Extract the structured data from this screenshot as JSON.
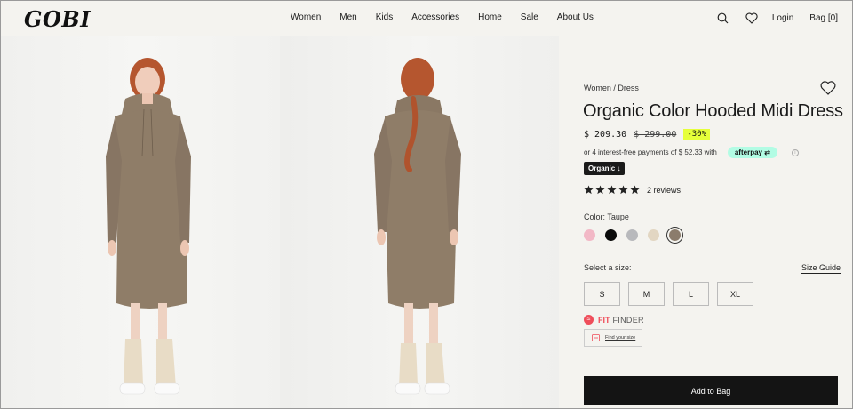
{
  "brand": {
    "logo": "GOBI"
  },
  "nav": {
    "items": [
      "Women",
      "Men",
      "Kids",
      "Accessories",
      "Home",
      "Sale",
      "About Us"
    ]
  },
  "header_right": {
    "login": "Login",
    "bag": "Bag [0]",
    "search_icon": "search-icon",
    "wishlist_icon": "heart-icon"
  },
  "product": {
    "breadcrumb": "Women / Dress",
    "title": "Organic Color Hooded Midi Dress",
    "price": "$ 209.30",
    "old_price": "$ 299.00",
    "discount": "-30%",
    "installments": "or 4 interest-free payments of $ 52.33 with",
    "afterpay": "afterpay",
    "organic_badge": "Organic ↓",
    "rating": 5,
    "reviews": "2 reviews",
    "color_label": "Color: Taupe",
    "colors": [
      "#f2b8c6",
      "#0b0b0b",
      "#b8b9bc",
      "#e2d6c2",
      "#8b7c6c"
    ],
    "selected_color_index": 4,
    "size_label": "Select a size:",
    "size_guide": "Size Guide",
    "sizes": [
      "S",
      "M",
      "L",
      "XL"
    ],
    "fit_finder": {
      "brand_a": "FIT",
      "brand_b": "FINDER",
      "link": "Find your size"
    },
    "add_to_bag": "Add to Bag"
  },
  "colors": {
    "accent_lime": "#e6ff3a",
    "afterpay_mint": "#b2fce4",
    "fit_red": "#ef4d5a",
    "dress_taupe": "#8f7d68"
  }
}
